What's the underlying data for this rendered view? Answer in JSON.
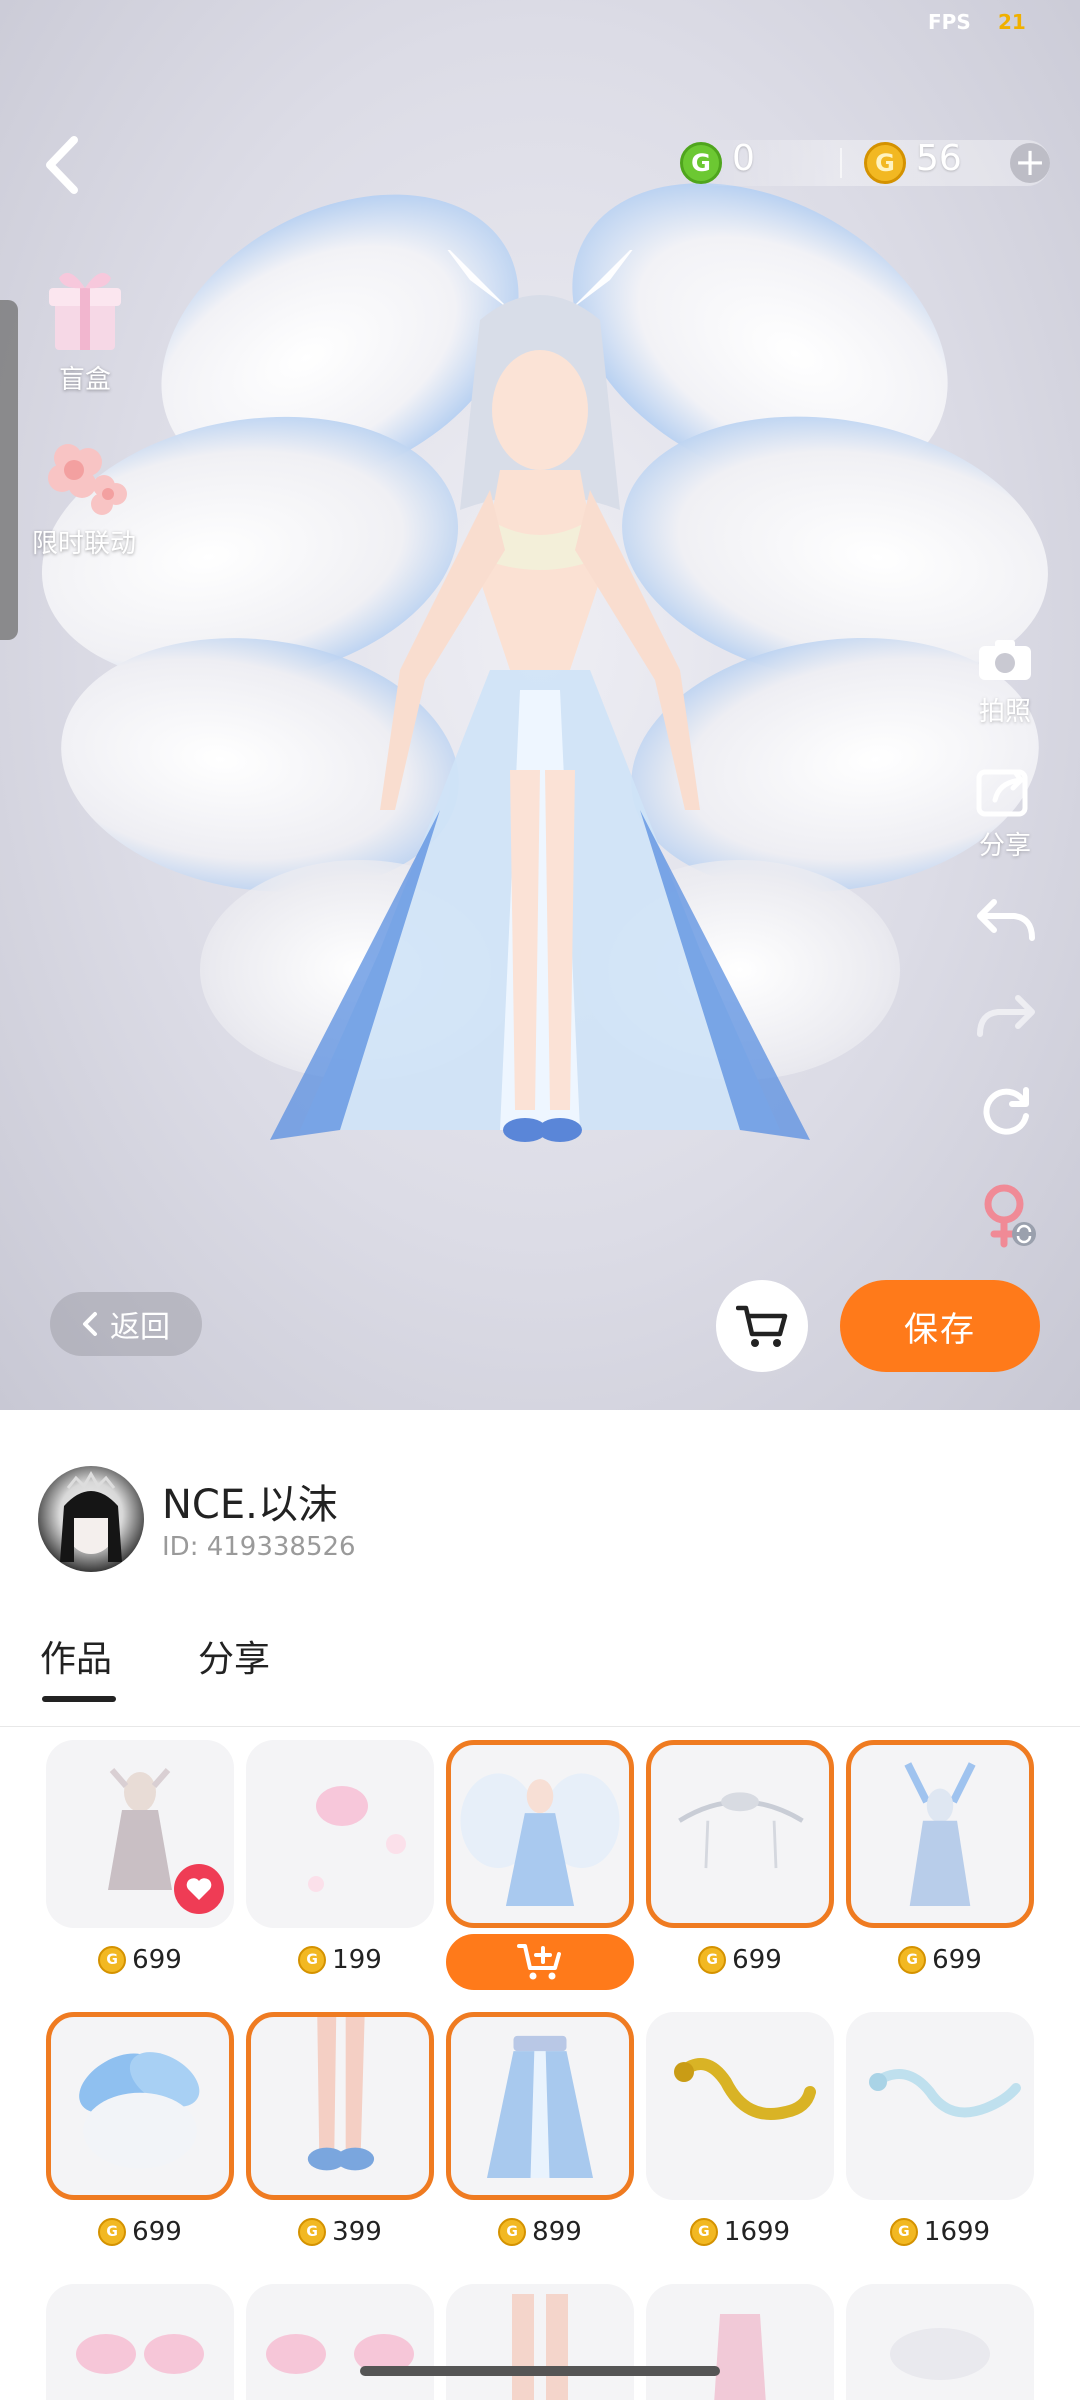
{
  "status": {
    "fps_label": "FPS",
    "fps_value": "21"
  },
  "currency": {
    "green_value": "0",
    "gold_value": "56",
    "green_coin_icon": "green-coin-icon",
    "gold_coin_icon": "gold-coin-icon",
    "add_icon": "plus-icon"
  },
  "left_menu": [
    {
      "label": "盲盒",
      "icon": "gift-box-icon"
    },
    {
      "label": "限时联动",
      "icon": "flower-icon"
    }
  ],
  "right_tools": {
    "photo_label": "拍照",
    "share_label": "分享",
    "undo_icon": "undo-icon",
    "redo_icon": "redo-icon",
    "reset_icon": "reset-icon",
    "gender_icon": "gender-switch-icon"
  },
  "actions": {
    "return_label": "返回",
    "save_label": "保存",
    "cart_icon": "cart-icon"
  },
  "profile": {
    "name": "NCE.以沫",
    "id_text": "ID: 419338526"
  },
  "tabs": [
    {
      "label": "作品",
      "active": true
    },
    {
      "label": "分享",
      "active": false
    }
  ],
  "colors": {
    "accent": "#ff7a1a",
    "selected_border": "#ef7b21",
    "coin": "#f2b822",
    "green": "#6cc832"
  },
  "items": [
    {
      "price": "699",
      "selected": false,
      "liked": true
    },
    {
      "price": "199",
      "selected": false
    },
    {
      "price": "",
      "selected": true,
      "add_to_cart": true
    },
    {
      "price": "699",
      "selected": true
    },
    {
      "price": "699",
      "selected": true
    },
    {
      "price": "699",
      "selected": true
    },
    {
      "price": "399",
      "selected": true
    },
    {
      "price": "899",
      "selected": true
    },
    {
      "price": "1699",
      "selected": false
    },
    {
      "price": "1699",
      "selected": false
    }
  ]
}
